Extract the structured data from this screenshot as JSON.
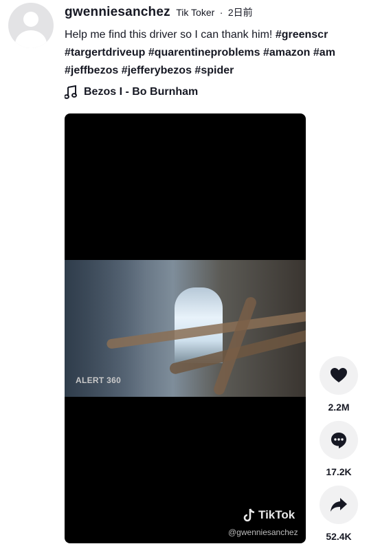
{
  "header": {
    "username": "gwenniesanchez",
    "nickname": "Tik Toker",
    "separator": "·",
    "posted": "2日前"
  },
  "caption": {
    "text": "Help me find this driver so I can thank him!",
    "line1_tags": [
      "#greenscr"
    ],
    "line2_tags": [
      "#targertdriveup",
      "#quarentineproblems",
      "#amazon",
      "#am"
    ],
    "line3_tags": [
      "#jeffbezos",
      "#jefferybezos",
      "#spider"
    ]
  },
  "music": {
    "icon": "music-note-icon",
    "title": "Bezos I - Bo Burnham"
  },
  "video": {
    "overlay_text": "ALERT 360",
    "watermark_brand": "TikTok",
    "watermark_user": "@gwenniesanchez"
  },
  "actions": {
    "like": {
      "icon": "heart-icon",
      "count": "2.2M"
    },
    "comment": {
      "icon": "comment-icon",
      "count": "17.2K"
    },
    "share": {
      "icon": "share-icon",
      "count": "52.4K"
    }
  }
}
